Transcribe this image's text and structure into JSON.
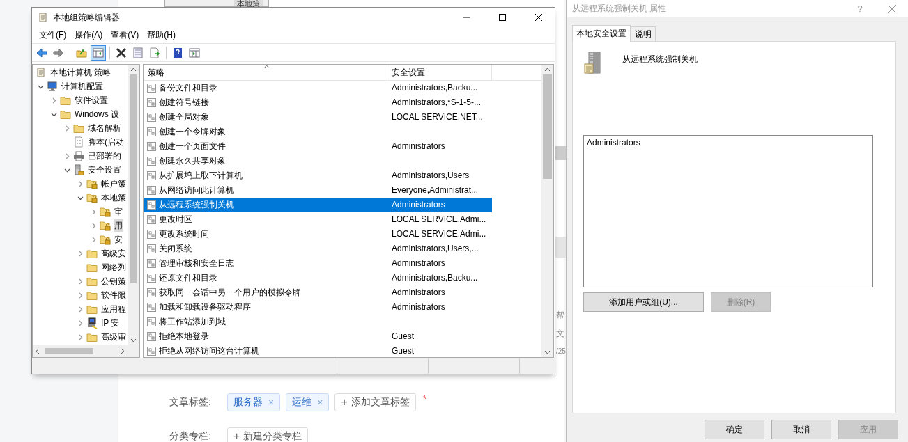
{
  "background_page": {
    "top_window_tab": "本地策",
    "side_texts": [
      "帮",
      "文",
      "/25"
    ],
    "form_rows": [
      {
        "label": "文章标签:",
        "tags": [
          {
            "text": "服务器",
            "remove": "×"
          },
          {
            "text": "运维",
            "remove": "×"
          }
        ],
        "add_button": {
          "icon": "+",
          "text": "添加文章标签"
        },
        "required_mark": "*"
      },
      {
        "label": "分类专栏:",
        "add_button": {
          "icon": "+",
          "text": "新建分类专栏"
        }
      }
    ]
  },
  "editor_window": {
    "title": "本地组策略编辑器",
    "menu": [
      "文件(F)",
      "操作(A)",
      "查看(V)",
      "帮助(H)"
    ],
    "toolbar": [
      {
        "kind": "back",
        "pressed": false
      },
      {
        "kind": "forward",
        "pressed": false
      },
      {
        "kind": "separator"
      },
      {
        "kind": "up",
        "pressed": false
      },
      {
        "kind": "tree",
        "pressed": true
      },
      {
        "kind": "separator"
      },
      {
        "kind": "delete",
        "pressed": false
      },
      {
        "kind": "properties",
        "pressed": false
      },
      {
        "kind": "export",
        "pressed": false
      },
      {
        "kind": "separator"
      },
      {
        "kind": "help",
        "pressed": false
      },
      {
        "kind": "view",
        "pressed": false
      }
    ],
    "tree": [
      {
        "label": "本地计算机 策略",
        "kind": "document",
        "selected": false,
        "children": [
          {
            "label": "计算机配置",
            "kind": "computer",
            "expanded": true,
            "selected": false,
            "children": [
              {
                "label": "软件设置",
                "kind": "folder",
                "expanded": false,
                "selected": false
              },
              {
                "label": "Windows 设",
                "kind": "folder",
                "expanded": true,
                "selected": false,
                "children": [
                  {
                    "label": "域名解析",
                    "kind": "folder",
                    "expanded": false,
                    "selected": false
                  },
                  {
                    "label": "脚本(启动",
                    "kind": "script",
                    "selected": false
                  },
                  {
                    "label": "已部署的",
                    "kind": "printer",
                    "expanded": false,
                    "selected": false
                  },
                  {
                    "label": "安全设置",
                    "kind": "server",
                    "expanded": true,
                    "selected": false,
                    "children": [
                      {
                        "label": "帐户策",
                        "kind": "locked-folder",
                        "expanded": false,
                        "selected": false
                      },
                      {
                        "label": "本地策",
                        "kind": "locked-folder",
                        "expanded": true,
                        "selected": false,
                        "children": [
                          {
                            "label": "审",
                            "kind": "locked-folder",
                            "expanded": false,
                            "selected": false
                          },
                          {
                            "label": "用",
                            "kind": "locked-folder",
                            "expanded": false,
                            "selected": true
                          },
                          {
                            "label": "安",
                            "kind": "locked-folder",
                            "expanded": false,
                            "selected": false
                          }
                        ]
                      },
                      {
                        "label": "高级安",
                        "kind": "folder",
                        "expanded": false,
                        "selected": false
                      },
                      {
                        "label": "网络列",
                        "kind": "folder",
                        "selected": false
                      },
                      {
                        "label": "公钥策",
                        "kind": "folder",
                        "expanded": false,
                        "selected": false
                      },
                      {
                        "label": "软件限",
                        "kind": "folder",
                        "expanded": false,
                        "selected": false
                      },
                      {
                        "label": "应用程",
                        "kind": "folder",
                        "expanded": false,
                        "selected": false
                      },
                      {
                        "label": "IP 安",
                        "kind": "network",
                        "expanded": false,
                        "selected": false
                      },
                      {
                        "label": "高级审",
                        "kind": "folder",
                        "expanded": false,
                        "selected": false
                      }
                    ]
                  }
                ]
              }
            ]
          }
        ]
      }
    ],
    "list": {
      "columns": [
        "策略",
        "安全设置"
      ],
      "rows": [
        {
          "policy": "备份文件和目录",
          "setting": "Administrators,Backu...",
          "selected": false
        },
        {
          "policy": "创建符号链接",
          "setting": "Administrators,*S-1-5-...",
          "selected": false
        },
        {
          "policy": "创建全局对象",
          "setting": "LOCAL SERVICE,NET...",
          "selected": false
        },
        {
          "policy": "创建一个令牌对象",
          "selected": false
        },
        {
          "policy": "创建一个页面文件",
          "setting": "Administrators",
          "selected": false
        },
        {
          "policy": "创建永久共享对象",
          "selected": false
        },
        {
          "policy": "从扩展坞上取下计算机",
          "setting": "Administrators,Users",
          "selected": false
        },
        {
          "policy": "从网络访问此计算机",
          "setting": "Everyone,Administrat...",
          "selected": false
        },
        {
          "policy": "从远程系统强制关机",
          "setting": "Administrators",
          "selected": true
        },
        {
          "policy": "更改时区",
          "setting": "LOCAL SERVICE,Admi...",
          "selected": false
        },
        {
          "policy": "更改系统时间",
          "setting": "LOCAL SERVICE,Admi...",
          "selected": false
        },
        {
          "policy": "关闭系统",
          "setting": "Administrators,Users,...",
          "selected": false
        },
        {
          "policy": "管理审核和安全日志",
          "setting": "Administrators",
          "selected": false
        },
        {
          "policy": "还原文件和目录",
          "setting": "Administrators,Backu...",
          "selected": false
        },
        {
          "policy": "获取同一会话中另一个用户的模拟令牌",
          "setting": "Administrators",
          "selected": false
        },
        {
          "policy": "加载和卸载设备驱动程序",
          "setting": "Administrators",
          "selected": false
        },
        {
          "policy": "将工作站添加到域",
          "selected": false
        },
        {
          "policy": "拒绝本地登录",
          "setting": "Guest",
          "selected": false
        },
        {
          "policy": "拒绝从网络访问这台计算机",
          "setting": "Guest",
          "selected": false
        }
      ]
    }
  },
  "properties_dialog": {
    "title": "从远程系统强制关机 属性",
    "help": "?",
    "tabs": [
      {
        "label": "本地安全设置",
        "selected": true
      },
      {
        "label": "说明",
        "selected": false
      }
    ],
    "heading": "从远程系统强制关机",
    "members": [
      "Administrators"
    ],
    "panel_buttons": [
      {
        "label": "添加用户或组(U)...",
        "disabled": false
      },
      {
        "label": "删除(R)",
        "disabled": true
      }
    ],
    "footer_buttons": [
      {
        "label": "确定",
        "disabled": false
      },
      {
        "label": "取消",
        "disabled": false
      },
      {
        "label": "应用",
        "disabled": true
      }
    ]
  }
}
